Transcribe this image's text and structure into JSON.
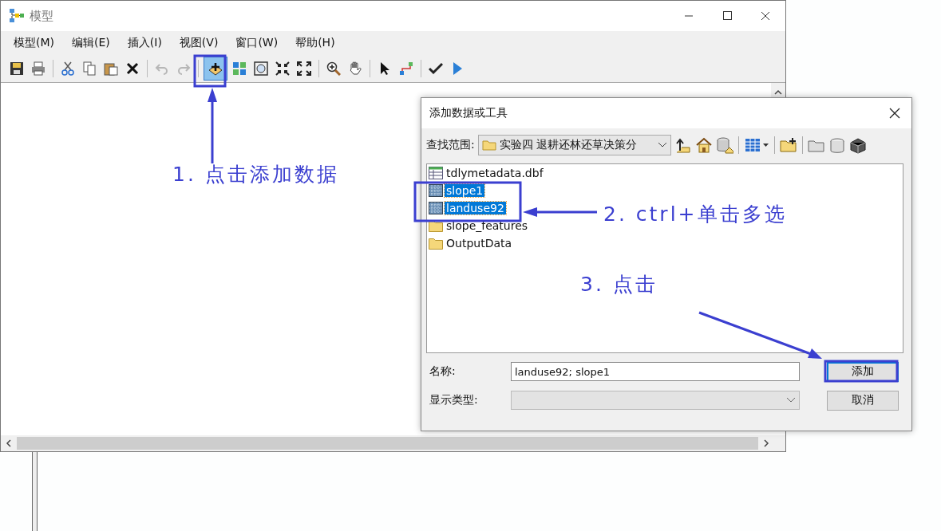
{
  "window": {
    "title": "模型"
  },
  "menu": [
    "模型(M)",
    "编辑(E)",
    "插入(I)",
    "视图(V)",
    "窗口(W)",
    "帮助(H)"
  ],
  "toolbar": {
    "groups": [
      [
        {
          "selected": false,
          "disabled": false
        },
        {
          "selected": false,
          "disabled": false
        }
      ],
      [
        {
          "selected": false,
          "disabled": false
        },
        {
          "selected": false,
          "disabled": false
        },
        {
          "selected": false,
          "disabled": false
        },
        {
          "selected": false,
          "disabled": false
        }
      ],
      [
        {
          "selected": false,
          "disabled": true
        },
        {
          "selected": false,
          "disabled": true
        }
      ],
      [
        {
          "selected": true,
          "disabled": false
        },
        {
          "selected": false,
          "disabled": false
        },
        {
          "selected": false,
          "disabled": false
        },
        {
          "selected": false,
          "disabled": false
        },
        {
          "selected": false,
          "disabled": false
        }
      ],
      [
        {
          "selected": false,
          "disabled": false
        },
        {
          "selected": false,
          "disabled": false
        }
      ],
      [
        {
          "selected": false,
          "disabled": false
        },
        {
          "selected": false,
          "disabled": false
        }
      ],
      [
        {
          "selected": false,
          "disabled": false
        },
        {
          "selected": false,
          "disabled": false
        }
      ]
    ]
  },
  "dialog": {
    "title": "添加数据或工具",
    "look_in_label": "查找范围:",
    "look_in_value": "实验四 退耕还林还草决策分",
    "items": [
      {
        "name": "tdlymetadata.dbf",
        "kind": "table",
        "selected": false
      },
      {
        "name": "slope1",
        "kind": "raster",
        "selected": true
      },
      {
        "name": "landuse92",
        "kind": "raster",
        "selected": true
      },
      {
        "name": "slope_features",
        "kind": "folder",
        "selected": false
      },
      {
        "name": "OutputData",
        "kind": "folder",
        "selected": false
      }
    ],
    "name_label": "名称:",
    "name_value": "landuse92; slope1",
    "type_label": "显示类型:",
    "buttons": [
      {
        "label": "添加",
        "default": true
      },
      {
        "label": "取消",
        "default": false
      }
    ]
  },
  "annotations": [
    {
      "text": "1. 点击添加数据"
    },
    {
      "text": "2. ctrl+单击多选"
    },
    {
      "text": "3. 点击"
    }
  ]
}
